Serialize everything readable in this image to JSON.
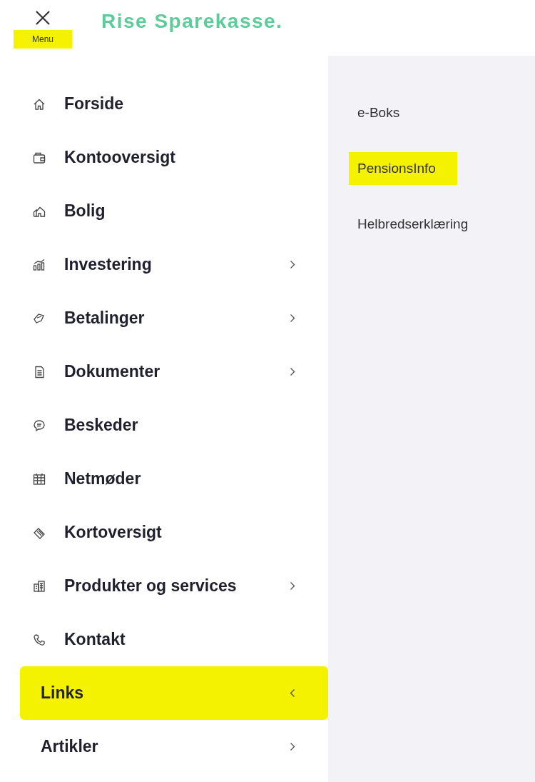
{
  "header": {
    "menu_label": "Menu",
    "menu_label_highlighted": true,
    "logo": "Rise Sparekasse."
  },
  "menu": [
    {
      "label": "Forside",
      "submenu": false,
      "expanded": false,
      "highlighted": false
    },
    {
      "label": "Kontooversigt",
      "submenu": false,
      "expanded": false,
      "highlighted": false
    },
    {
      "label": "Bolig",
      "submenu": false,
      "expanded": false,
      "highlighted": false
    },
    {
      "label": "Investering",
      "submenu": true,
      "expanded": false,
      "highlighted": false
    },
    {
      "label": "Betalinger",
      "submenu": true,
      "expanded": false,
      "highlighted": false
    },
    {
      "label": "Dokumenter",
      "submenu": true,
      "expanded": false,
      "highlighted": false
    },
    {
      "label": "Beskeder",
      "submenu": false,
      "expanded": false,
      "highlighted": false
    },
    {
      "label": "Netmøder",
      "submenu": false,
      "expanded": false,
      "highlighted": false
    },
    {
      "label": "Kortoversigt",
      "submenu": false,
      "expanded": false,
      "highlighted": false
    },
    {
      "label": "Produkter og services",
      "submenu": true,
      "expanded": false,
      "highlighted": false
    },
    {
      "label": "Kontakt",
      "submenu": false,
      "expanded": false,
      "highlighted": false
    },
    {
      "label": "Links",
      "submenu": true,
      "expanded": true,
      "highlighted": true
    },
    {
      "label": "Artikler",
      "submenu": true,
      "expanded": false,
      "highlighted": false
    }
  ],
  "submenu": [
    {
      "label": "e-Boks",
      "highlighted": false
    },
    {
      "label": "PensionsInfo",
      "highlighted": true
    },
    {
      "label": "Helbredserklæring",
      "highlighted": false
    }
  ]
}
